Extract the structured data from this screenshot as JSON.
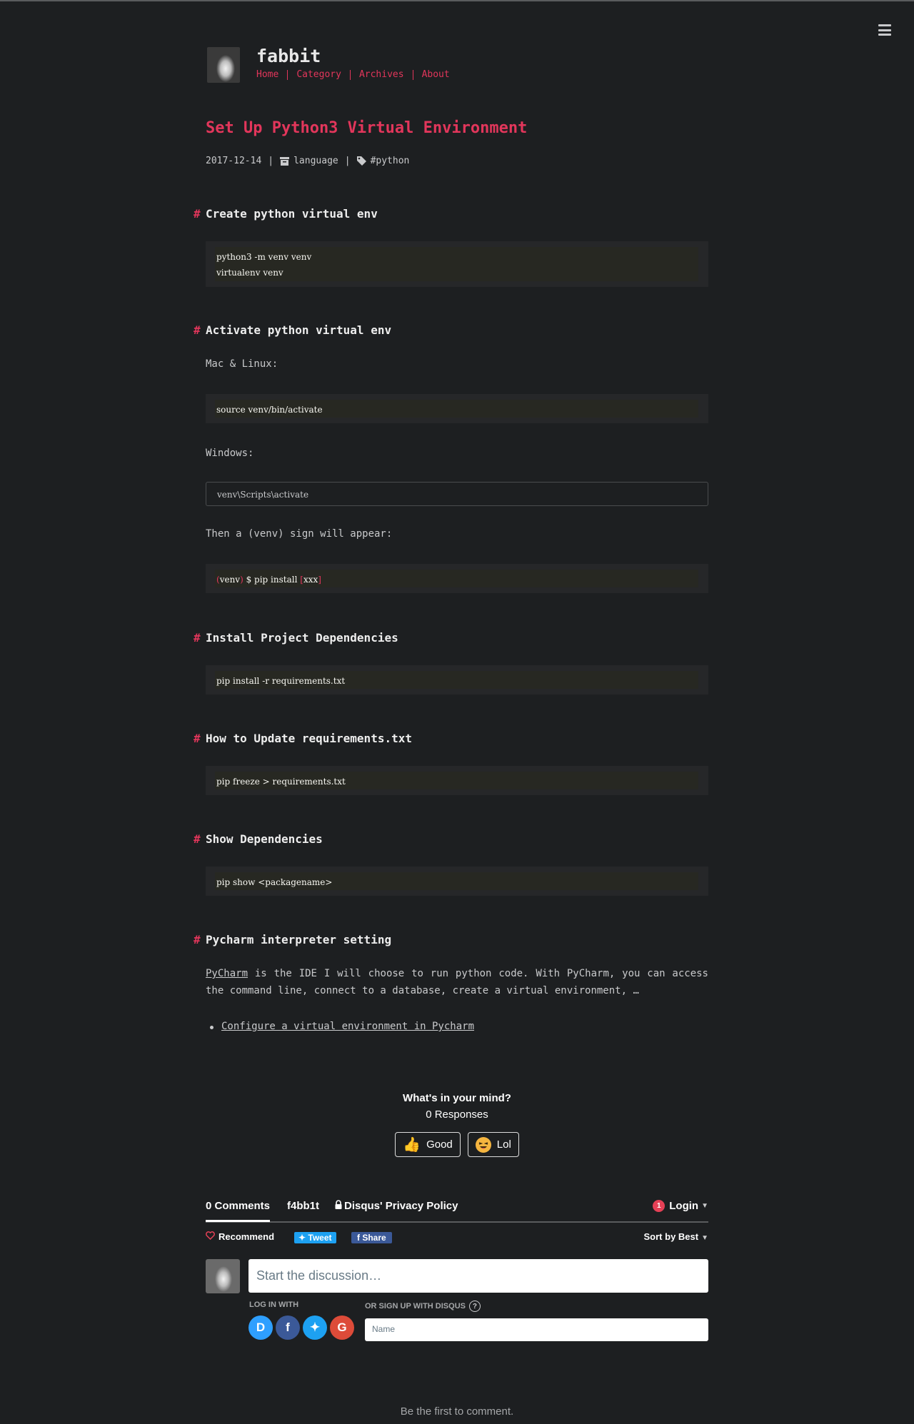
{
  "site": {
    "title": "fabbit",
    "nav": [
      "Home",
      "Category",
      "Archives",
      "About"
    ]
  },
  "post": {
    "title": "Set Up Python3 Virtual Environment",
    "date": "2017-12-14",
    "category": "language",
    "tag": "#python",
    "sections": {
      "s1": {
        "heading": "Create python virtual env",
        "code": [
          "python3 -m venv venv",
          "virtualenv venv"
        ]
      },
      "s2": {
        "heading": "Activate python virtual env",
        "mac_label": "Mac & Linux:",
        "mac_code": "source venv/bin/activate",
        "win_label": "Windows:",
        "win_code": "venv\\Scripts\\activate",
        "venv_label": "Then a (venv) sign will appear:",
        "venv_code": {
          "open": "(",
          "env": "venv",
          "close": ")",
          "mid": " $ pip install ",
          "arg_open": "[",
          "arg": "xxx",
          "arg_close": "]"
        }
      },
      "s3": {
        "heading": "Install Project Dependencies",
        "code": "pip install -r requirements.txt"
      },
      "s4": {
        "heading": "How to Update requirements.txt",
        "code": "pip freeze > requirements.txt"
      },
      "s5": {
        "heading": "Show Dependencies",
        "code": "pip show <packagename>"
      },
      "s6": {
        "heading": "Pycharm interpreter setting",
        "link": "PyCharm",
        "text": " is the IDE I will choose to run python code. With PyCharm, you can access the command line, connect to a database, create a virtual environment, …",
        "list_link": "Configure a virtual environment in Pycharm"
      }
    }
  },
  "reactions": {
    "question": "What's in your mind?",
    "responses": "0 Responses",
    "good": "Good",
    "lol": "Lol"
  },
  "disqus": {
    "tab_comments": "0 Comments",
    "tab_user": "f4bb1t",
    "tab_privacy": "Disqus' Privacy Policy",
    "notif_count": "1",
    "login": "Login",
    "recommend": "Recommend",
    "tweet": "Tweet",
    "share": "Share",
    "sort": "Sort by Best",
    "start_placeholder": "Start the discussion…",
    "log_in_with": "LOG IN WITH",
    "sign_up": "OR SIGN UP WITH DISQUS",
    "name_placeholder": "Name",
    "first": "Be the first to comment."
  },
  "colors": {
    "accent": "#e2365b",
    "background": "#1d1f21",
    "code_bg": "#272822"
  }
}
